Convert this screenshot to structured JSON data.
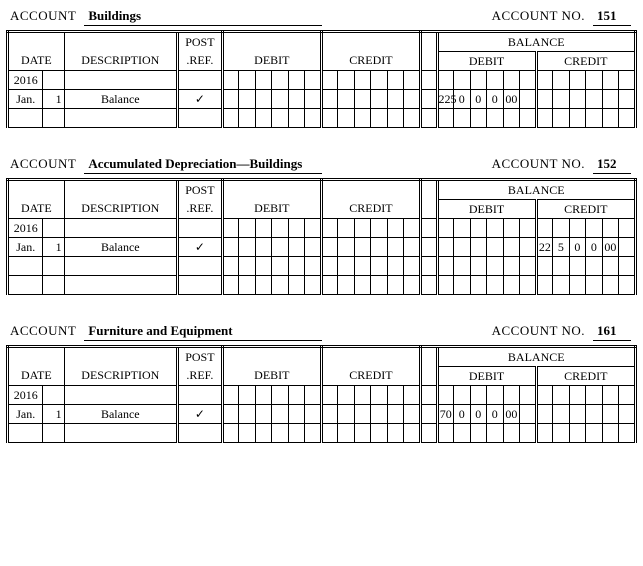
{
  "labels": {
    "account": "ACCOUNT",
    "account_no": "ACCOUNT NO.",
    "account_no_short": "ACCOUNT NO.",
    "date": "DATE",
    "description": "DESCRIPTION",
    "post_ref_1": "POST",
    "post_ref_2": ".REF.",
    "debit": "DEBIT",
    "credit": "CREDIT",
    "balance": "BALANCE"
  },
  "check_mark": "✓",
  "ledgers": [
    {
      "name": "Buildings",
      "number": "151",
      "no_label_key": "account_no",
      "rows": [
        {
          "month": "2016",
          "day": "",
          "desc": "",
          "ref": "",
          "debit": [
            "",
            "",
            "",
            "",
            "",
            ""
          ],
          "credit": [
            "",
            "",
            "",
            "",
            "",
            ""
          ],
          "bal_debit": [
            "",
            "",
            "",
            "",
            "",
            ""
          ],
          "bal_credit": [
            "",
            "",
            "",
            "",
            "",
            ""
          ]
        },
        {
          "month": "Jan.",
          "day": "1",
          "desc": "Balance",
          "ref": "CHECK",
          "debit": [
            "",
            "",
            "",
            "",
            "",
            ""
          ],
          "credit": [
            "",
            "",
            "",
            "",
            "",
            ""
          ],
          "bal_debit": [
            "225",
            "0",
            "0",
            "0",
            "00",
            ""
          ],
          "bal_credit": [
            "",
            "",
            "",
            "",
            "",
            ""
          ]
        },
        {
          "month": "",
          "day": "",
          "desc": "",
          "ref": "",
          "debit": [
            "",
            "",
            "",
            "",
            "",
            ""
          ],
          "credit": [
            "",
            "",
            "",
            "",
            "",
            ""
          ],
          "bal_debit": [
            "",
            "",
            "",
            "",
            "",
            ""
          ],
          "bal_credit": [
            "",
            "",
            "",
            "",
            "",
            ""
          ]
        }
      ]
    },
    {
      "name": "Accumulated Depreciation—Buildings",
      "number": "152",
      "no_label_key": "account_no_short",
      "rows": [
        {
          "month": "2016",
          "day": "",
          "desc": "",
          "ref": "",
          "debit": [
            "",
            "",
            "",
            "",
            "",
            ""
          ],
          "credit": [
            "",
            "",
            "",
            "",
            "",
            ""
          ],
          "bal_debit": [
            "",
            "",
            "",
            "",
            "",
            ""
          ],
          "bal_credit": [
            "",
            "",
            "",
            "",
            "",
            ""
          ]
        },
        {
          "month": "Jan.",
          "day": "1",
          "desc": "Balance",
          "ref": "CHECK",
          "debit": [
            "",
            "",
            "",
            "",
            "",
            ""
          ],
          "credit": [
            "",
            "",
            "",
            "",
            "",
            ""
          ],
          "bal_debit": [
            "",
            "",
            "",
            "",
            "",
            ""
          ],
          "bal_credit": [
            "22",
            "5",
            "0",
            "0",
            "00",
            ""
          ]
        },
        {
          "month": "",
          "day": "",
          "desc": "",
          "ref": "",
          "debit": [
            "",
            "",
            "",
            "",
            "",
            ""
          ],
          "credit": [
            "",
            "",
            "",
            "",
            "",
            ""
          ],
          "bal_debit": [
            "",
            "",
            "",
            "",
            "",
            ""
          ],
          "bal_credit": [
            "",
            "",
            "",
            "",
            "",
            ""
          ]
        },
        {
          "month": "",
          "day": "",
          "desc": "",
          "ref": "",
          "debit": [
            "",
            "",
            "",
            "",
            "",
            ""
          ],
          "credit": [
            "",
            "",
            "",
            "",
            "",
            ""
          ],
          "bal_debit": [
            "",
            "",
            "",
            "",
            "",
            ""
          ],
          "bal_credit": [
            "",
            "",
            "",
            "",
            "",
            ""
          ]
        }
      ]
    },
    {
      "name": "Furniture and Equipment",
      "number": "161",
      "no_label_key": "account_no",
      "rows": [
        {
          "month": "2016",
          "day": "",
          "desc": "",
          "ref": "",
          "debit": [
            "",
            "",
            "",
            "",
            "",
            ""
          ],
          "credit": [
            "",
            "",
            "",
            "",
            "",
            ""
          ],
          "bal_debit": [
            "",
            "",
            "",
            "",
            "",
            ""
          ],
          "bal_credit": [
            "",
            "",
            "",
            "",
            "",
            ""
          ]
        },
        {
          "month": "Jan.",
          "day": "1",
          "desc": "Balance",
          "ref": "CHECK",
          "debit": [
            "",
            "",
            "",
            "",
            "",
            ""
          ],
          "credit": [
            "",
            "",
            "",
            "",
            "",
            ""
          ],
          "bal_debit": [
            "70",
            "0",
            "0",
            "0",
            "00",
            ""
          ],
          "bal_credit": [
            "",
            "",
            "",
            "",
            "",
            ""
          ]
        },
        {
          "month": "",
          "day": "",
          "desc": "",
          "ref": "",
          "debit": [
            "",
            "",
            "",
            "",
            "",
            ""
          ],
          "credit": [
            "",
            "",
            "",
            "",
            "",
            ""
          ],
          "bal_debit": [
            "",
            "",
            "",
            "",
            "",
            ""
          ],
          "bal_credit": [
            "",
            "",
            "",
            "",
            "",
            ""
          ]
        }
      ]
    }
  ]
}
